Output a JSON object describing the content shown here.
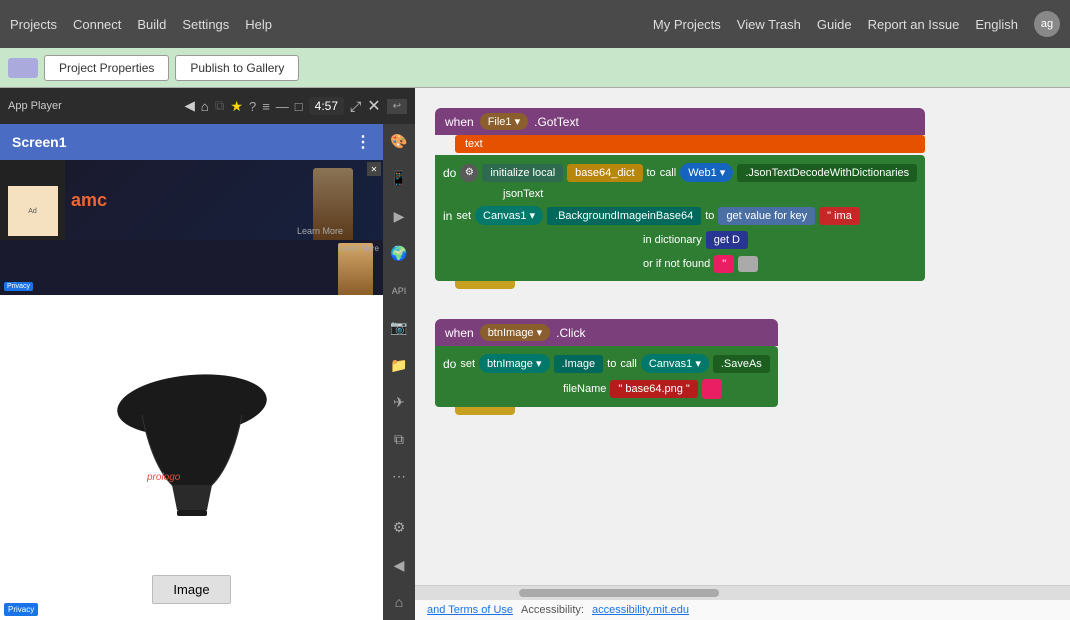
{
  "topnav": {
    "left": [
      {
        "label": "Projects",
        "has_dropdown": true
      },
      {
        "label": "Connect",
        "has_dropdown": true
      },
      {
        "label": "Build",
        "has_dropdown": true
      },
      {
        "label": "Settings",
        "has_dropdown": true
      },
      {
        "label": "Help",
        "has_dropdown": true
      }
    ],
    "right": [
      {
        "label": "My Projects",
        "key": "my-projects"
      },
      {
        "label": "View Trash",
        "key": "view-trash"
      },
      {
        "label": "Guide",
        "key": "guide"
      },
      {
        "label": "Report an Issue",
        "key": "report-issue"
      },
      {
        "label": "English",
        "key": "english",
        "has_dropdown": true
      },
      {
        "label": "ag",
        "key": "user-avatar"
      }
    ]
  },
  "tabs": [
    {
      "label": "Project Properties",
      "key": "project-properties"
    },
    {
      "label": "Publish to Gallery",
      "key": "publish-gallery"
    }
  ],
  "app_player": {
    "title": "App Player",
    "timer": "4:57",
    "screen_name": "Screen1"
  },
  "blocks": {
    "block1": {
      "when": "when",
      "component": "File1",
      "event": ".GotText",
      "param": "text",
      "do": "do",
      "init_local": "initialize local",
      "var_name": "base64_dict",
      "to": "to",
      "call": "call",
      "web": "Web1",
      "method": ".JsonTextDecodeWithDictionaries",
      "json_text": "jsonText",
      "in": "in",
      "set": "set",
      "canvas": "Canvas1",
      "prop": ".BackgroundImageinBase64",
      "get_value": "get value for key",
      "key_label": "\" ima",
      "in_dict": "in dictionary",
      "get_label": "get D",
      "or_not_found": "or if not found",
      "not_found_val": "\""
    },
    "block2": {
      "when": "when",
      "component": "btnImage",
      "event": ".Click",
      "do": "do",
      "set": "set",
      "btn": "btnImage",
      "prop": ".Image",
      "to": "to",
      "call": "call",
      "canvas": "Canvas1",
      "method": ".SaveAs",
      "file_name": "fileName",
      "value": "\" base64.png \""
    }
  },
  "footer": {
    "terms_text": "and Terms of Use",
    "accessibility_text": "Accessibility:",
    "accessibility_link": "accessibility.mit.edu"
  },
  "dictionary_label": "dictionary",
  "text_label": "text"
}
